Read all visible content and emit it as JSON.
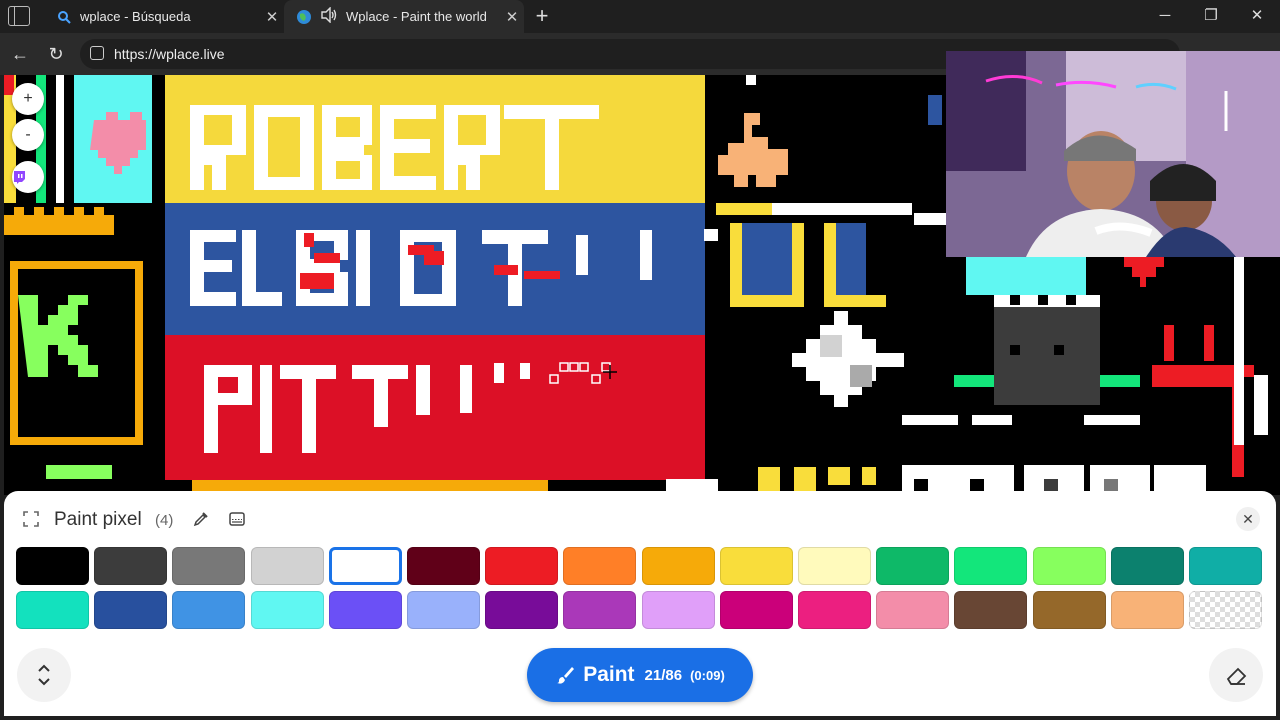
{
  "browser": {
    "tabs": [
      {
        "title": "wplace - Búsqueda",
        "favicon": "search-icon"
      },
      {
        "title": "Wplace - Paint the world",
        "favicon": "globe-icon",
        "audio": "speaker-icon"
      }
    ],
    "url": "https://wplace.live"
  },
  "canvas": {
    "banner_lines": [
      "ROBERT",
      "EL BIO TI I",
      "PIT TI I"
    ],
    "banner_colors": {
      "yellow": "#f5d93c",
      "blue": "#2d55a0",
      "red": "#dc1026"
    }
  },
  "panel": {
    "title": "Paint pixel",
    "count": "(4)",
    "palette": [
      "#000000",
      "#3c3c3c",
      "#787878",
      "#d2d2d2",
      "#ffffff",
      "#600018",
      "#ed1c24",
      "#ff7f27",
      "#f6aa09",
      "#f9dd3b",
      "#fffabc",
      "#0eb968",
      "#13e67b",
      "#87ff5e",
      "#0c816e",
      "#10aea6",
      "#13e1be",
      "#28509e",
      "#4093e4",
      "#60f7f2",
      "#6b50f6",
      "#99b1fb",
      "#780c99",
      "#aa38b9",
      "#e09ff9",
      "#cb007a",
      "#ec1f80",
      "#f38da9",
      "#684634",
      "#95682a",
      "#f8b277",
      "transparent"
    ],
    "selected_index": 4,
    "paint_button": {
      "label": "Paint",
      "count": "21/86",
      "timer": "(0:09)"
    },
    "accent": "#1a6fe6"
  }
}
